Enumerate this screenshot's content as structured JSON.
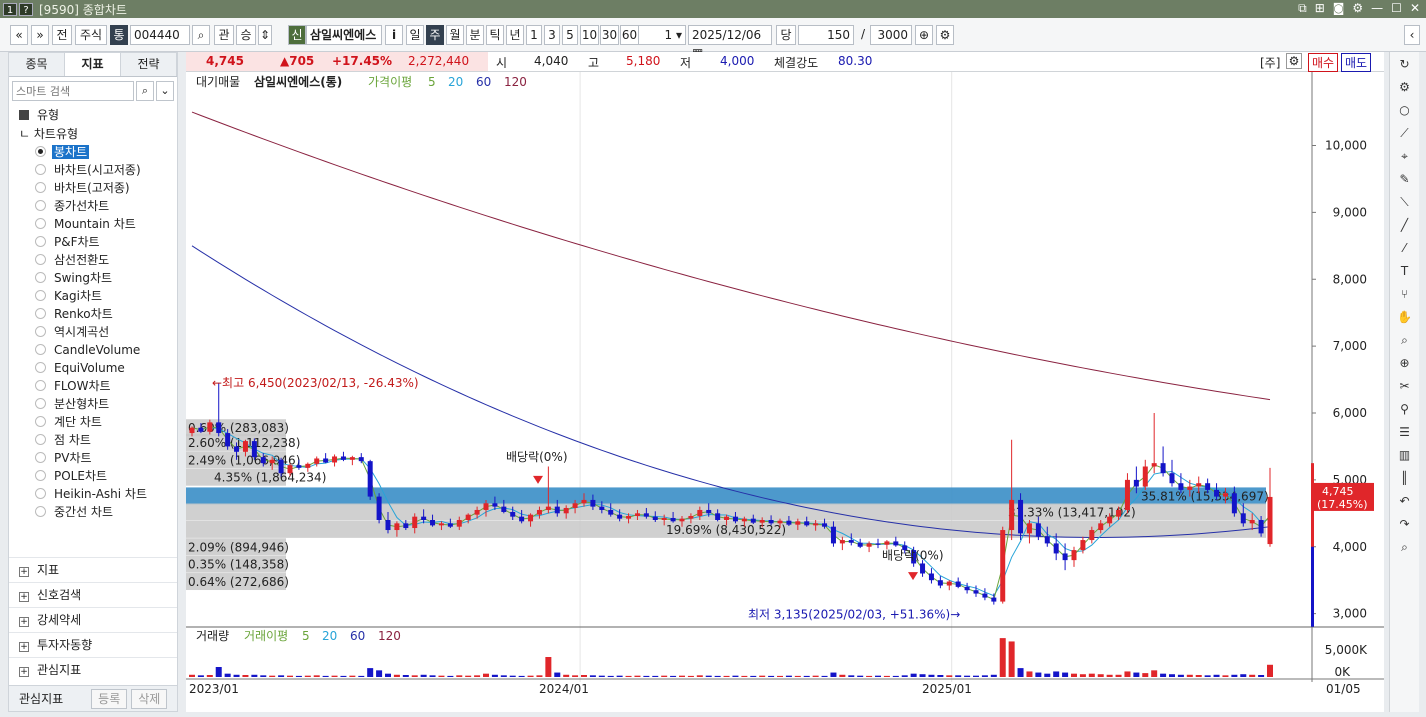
{
  "titlebar": {
    "code": "[9590]",
    "title": "종합차트",
    "box1": "1",
    "box2": "?"
  },
  "toolbar": {
    "btn_prev": "«",
    "btn_down": "»",
    "btn_jeon": "전",
    "btn_stock": "주식",
    "btn_tong": "통",
    "code": "004440",
    "btn_gwan": "관",
    "btn_seung": "승",
    "badge_new": "신",
    "name": "삼일씨엔에스",
    "btn_info": "i",
    "periods": [
      "일",
      "주",
      "월",
      "분",
      "틱",
      "년"
    ],
    "active_period": "주",
    "intervals": [
      "1",
      "3",
      "5",
      "10",
      "30",
      "60"
    ],
    "interval_value": "1",
    "date": "2025/12/06",
    "btn_dang": "당",
    "count": "150",
    "slash": "/",
    "total": "3000"
  },
  "sidebar": {
    "tabs": [
      "종목",
      "지표",
      "전략"
    ],
    "active_tab": "지표",
    "search_placeholder": "스마트 검색",
    "section_type": "유형",
    "chart_type_header": "차트유형",
    "chart_types": [
      "봉차트",
      "바차트(시고저종)",
      "바차트(고저종)",
      "종가선차트",
      "Mountain 차트",
      "P&F차트",
      "삼선전환도",
      "Swing차트",
      "Kagi차트",
      "Renko차트",
      "역시계곡선",
      "CandleVolume",
      "EquiVolume",
      "FLOW차트",
      "분산형차트",
      "계단 차트",
      "점 차트",
      "PV차트",
      "POLE차트",
      "Heikin-Ashi 차트",
      "중간선 차트"
    ],
    "selected_type": "봉차트",
    "groups": [
      "지표",
      "신호검색",
      "강세약세",
      "투자자동향",
      "관심지표"
    ],
    "watch_label": "관심지표",
    "watch_add": "등록",
    "watch_del": "삭제"
  },
  "pricebar": {
    "price": "4,745",
    "change": "▲705",
    "change_pct": "+17.45%",
    "volume": "2,272,440",
    "open_label": "시",
    "open": "4,040",
    "high_label": "고",
    "high": "5,180",
    "low_label": "저",
    "low": "4,000",
    "strength_label": "체결강도",
    "strength": "80.30",
    "unit_label": "[주]",
    "buy": "매수",
    "sell": "매도"
  },
  "legend": {
    "main": "대기매물",
    "name": "삼일씨엔에스(통)",
    "ma_label": "가격이평",
    "ma": [
      "5",
      "20",
      "60",
      "120"
    ],
    "vol": "거래량",
    "vol_ma_label": "거래이평",
    "vol_ma": [
      "5",
      "20",
      "60",
      "120"
    ]
  },
  "colors": {
    "up": "#e0262a",
    "down": "#1414c8",
    "ma5": "#6aa43a",
    "ma20": "#28a4d8",
    "ma60": "#2630a8",
    "ma120": "#8a2240",
    "band": "#3a8ec6",
    "band_gray": "#c8c8c8"
  },
  "annotations": {
    "high": "←최고 6,450(2023/02/13, -26.43%)",
    "low": "최저 3,135(2025/02/03, +51.36%)→",
    "div1": "배당락(0%)",
    "div2": "배당락(0%)"
  },
  "chart_data": {
    "type": "candlestick",
    "x_ticks": [
      "2023/01",
      "2024/01",
      "2025/01",
      "01/05"
    ],
    "y_ticks": [
      "10,000",
      "9,000",
      "8,000",
      "7,000",
      "6,000",
      "5,000",
      "4,000",
      "3,000"
    ],
    "ylim": [
      2800,
      10800
    ],
    "last_price_label": "4,745",
    "last_price_pct": "(17.45%)",
    "volume_ticks": [
      "5,000K",
      "0K"
    ],
    "volume_profile": [
      {
        "price": 5780,
        "label": "0.60% (283,083)"
      },
      {
        "price": 5560,
        "label": "2.60% (1,112,238)"
      },
      {
        "price": 5300,
        "label": "2.49% (1,066,946)"
      },
      {
        "price": 5040,
        "label": "4.35% (1,864,234)"
      },
      {
        "price": 4760,
        "label": "35.81% (15,334,697)"
      },
      {
        "price": 4520,
        "label": "31.33% (13,417,102)"
      },
      {
        "price": 4260,
        "label": "19.69% (8,430,522)"
      },
      {
        "price": 4000,
        "label": "2.09% (894,946)"
      },
      {
        "price": 3740,
        "label": "0.35% (148,358)"
      },
      {
        "price": 3480,
        "label": "0.64% (272,686)"
      }
    ],
    "candles": [
      [
        5700,
        5800,
        5650,
        5780
      ],
      [
        5780,
        5850,
        5700,
        5720
      ],
      [
        5720,
        5900,
        5680,
        5860
      ],
      [
        5860,
        6450,
        5650,
        5700
      ],
      [
        5700,
        5760,
        5450,
        5500
      ],
      [
        5500,
        5560,
        5300,
        5420
      ],
      [
        5420,
        5600,
        5350,
        5580
      ],
      [
        5580,
        5620,
        5300,
        5340
      ],
      [
        5340,
        5400,
        5200,
        5250
      ],
      [
        5250,
        5350,
        5150,
        5300
      ],
      [
        5300,
        5330,
        5050,
        5100
      ],
      [
        5100,
        5250,
        5050,
        5220
      ],
      [
        5220,
        5300,
        5150,
        5180
      ],
      [
        5180,
        5260,
        5120,
        5240
      ],
      [
        5240,
        5350,
        5200,
        5320
      ],
      [
        5320,
        5400,
        5250,
        5260
      ],
      [
        5260,
        5380,
        5200,
        5350
      ],
      [
        5350,
        5420,
        5280,
        5300
      ],
      [
        5300,
        5360,
        5220,
        5340
      ],
      [
        5340,
        5400,
        5250,
        5280
      ],
      [
        5280,
        5300,
        4700,
        4750
      ],
      [
        4750,
        4800,
        4350,
        4400
      ],
      [
        4400,
        4520,
        4200,
        4250
      ],
      [
        4250,
        4380,
        4150,
        4350
      ],
      [
        4350,
        4400,
        4250,
        4280
      ],
      [
        4280,
        4500,
        4200,
        4450
      ],
      [
        4450,
        4560,
        4350,
        4400
      ],
      [
        4400,
        4480,
        4300,
        4320
      ],
      [
        4320,
        4380,
        4250,
        4350
      ],
      [
        4350,
        4420,
        4280,
        4300
      ],
      [
        4300,
        4450,
        4250,
        4400
      ],
      [
        4400,
        4500,
        4350,
        4480
      ],
      [
        4480,
        4600,
        4420,
        4550
      ],
      [
        4550,
        4700,
        4450,
        4650
      ],
      [
        4650,
        4750,
        4550,
        4600
      ],
      [
        4600,
        4700,
        4500,
        4520
      ],
      [
        4520,
        4600,
        4400,
        4450
      ],
      [
        4450,
        4550,
        4350,
        4380
      ],
      [
        4380,
        4500,
        4300,
        4480
      ],
      [
        4480,
        4600,
        4420,
        4550
      ],
      [
        4550,
        5200,
        4500,
        4600
      ],
      [
        4600,
        4700,
        4450,
        4500
      ],
      [
        4500,
        4620,
        4420,
        4580
      ],
      [
        4580,
        4700,
        4500,
        4650
      ],
      [
        4650,
        4800,
        4600,
        4700
      ],
      [
        4700,
        4780,
        4550,
        4600
      ],
      [
        4600,
        4680,
        4500,
        4550
      ],
      [
        4550,
        4650,
        4450,
        4480
      ],
      [
        4480,
        4560,
        4380,
        4420
      ],
      [
        4420,
        4500,
        4350,
        4460
      ],
      [
        4460,
        4550,
        4400,
        4500
      ],
      [
        4500,
        4580,
        4420,
        4450
      ],
      [
        4450,
        4530,
        4370,
        4400
      ],
      [
        4400,
        4480,
        4320,
        4430
      ],
      [
        4430,
        4520,
        4360,
        4380
      ],
      [
        4380,
        4460,
        4300,
        4420
      ],
      [
        4420,
        4500,
        4350,
        4460
      ],
      [
        4460,
        4600,
        4400,
        4550
      ],
      [
        4550,
        4650,
        4450,
        4500
      ],
      [
        4500,
        4560,
        4380,
        4400
      ],
      [
        4400,
        4480,
        4320,
        4450
      ],
      [
        4450,
        4520,
        4350,
        4380
      ],
      [
        4380,
        4450,
        4300,
        4420
      ],
      [
        4420,
        4480,
        4340,
        4360
      ],
      [
        4360,
        4440,
        4290,
        4400
      ],
      [
        4400,
        4470,
        4320,
        4350
      ],
      [
        4350,
        4420,
        4280,
        4390
      ],
      [
        4390,
        4460,
        4310,
        4330
      ],
      [
        4330,
        4420,
        4250,
        4380
      ],
      [
        4380,
        4450,
        4300,
        4320
      ],
      [
        4320,
        4400,
        4240,
        4350
      ],
      [
        4350,
        4420,
        4270,
        4300
      ],
      [
        4300,
        4380,
        4000,
        4050
      ],
      [
        4050,
        4150,
        3950,
        4100
      ],
      [
        4100,
        4200,
        4020,
        4060
      ],
      [
        4060,
        4120,
        3980,
        4000
      ],
      [
        4000,
        4080,
        3920,
        4050
      ],
      [
        4050,
        4120,
        3980,
        4030
      ],
      [
        4030,
        4100,
        3960,
        4080
      ],
      [
        4080,
        4150,
        4000,
        4020
      ],
      [
        4020,
        4080,
        3900,
        3950
      ],
      [
        3950,
        4000,
        3700,
        3750
      ],
      [
        3750,
        3800,
        3550,
        3600
      ],
      [
        3600,
        3680,
        3450,
        3500
      ],
      [
        3500,
        3560,
        3380,
        3420
      ],
      [
        3420,
        3500,
        3350,
        3480
      ],
      [
        3480,
        3540,
        3380,
        3400
      ],
      [
        3400,
        3460,
        3300,
        3350
      ],
      [
        3350,
        3420,
        3250,
        3300
      ],
      [
        3300,
        3380,
        3200,
        3240
      ],
      [
        3240,
        3300,
        3135,
        3180
      ],
      [
        3180,
        4300,
        3150,
        4250
      ],
      [
        4250,
        5600,
        4100,
        4700
      ],
      [
        4700,
        4800,
        4100,
        4200
      ],
      [
        4200,
        4400,
        4050,
        4350
      ],
      [
        4350,
        4450,
        4100,
        4150
      ],
      [
        4150,
        4300,
        4000,
        4050
      ],
      [
        4050,
        4200,
        3800,
        3900
      ],
      [
        3900,
        4050,
        3650,
        3800
      ],
      [
        3800,
        4000,
        3700,
        3950
      ],
      [
        3950,
        4150,
        3900,
        4100
      ],
      [
        4100,
        4300,
        4050,
        4250
      ],
      [
        4250,
        4400,
        4200,
        4350
      ],
      [
        4350,
        4500,
        4300,
        4450
      ],
      [
        4450,
        4600,
        4400,
        4550
      ],
      [
        4550,
        5100,
        4500,
        5000
      ],
      [
        5000,
        5200,
        4800,
        4900
      ],
      [
        4900,
        5300,
        4850,
        5200
      ],
      [
        5200,
        6000,
        5100,
        5250
      ],
      [
        5250,
        5500,
        5050,
        5100
      ],
      [
        5100,
        5300,
        4900,
        4950
      ],
      [
        4950,
        5100,
        4800,
        4850
      ],
      [
        4850,
        5000,
        4750,
        4900
      ],
      [
        4900,
        5050,
        4800,
        4950
      ],
      [
        4950,
        5020,
        4800,
        4850
      ],
      [
        4850,
        4950,
        4700,
        4750
      ],
      [
        4750,
        4880,
        4650,
        4800
      ],
      [
        4800,
        4900,
        4450,
        4500
      ],
      [
        4500,
        4650,
        4300,
        4350
      ],
      [
        4350,
        4500,
        4250,
        4400
      ],
      [
        4400,
        4460,
        4150,
        4200
      ],
      [
        4040,
        5180,
        4000,
        4745
      ]
    ],
    "volumes": [
      0.2,
      0.15,
      0.18,
      0.9,
      0.3,
      0.2,
      0.18,
      0.2,
      0.15,
      0.12,
      0.15,
      0.12,
      0.1,
      0.12,
      0.15,
      0.1,
      0.12,
      0.1,
      0.12,
      0.1,
      0.8,
      0.6,
      0.3,
      0.2,
      0.18,
      0.15,
      0.2,
      0.15,
      0.12,
      0.1,
      0.15,
      0.12,
      0.15,
      0.3,
      0.2,
      0.15,
      0.12,
      0.1,
      0.12,
      0.15,
      1.8,
      0.4,
      0.2,
      0.15,
      0.18,
      0.15,
      0.12,
      0.1,
      0.12,
      0.1,
      0.12,
      0.1,
      0.1,
      0.12,
      0.1,
      0.12,
      0.1,
      0.15,
      0.12,
      0.1,
      0.1,
      0.12,
      0.1,
      0.1,
      0.12,
      0.1,
      0.1,
      0.12,
      0.1,
      0.1,
      0.12,
      0.1,
      0.4,
      0.2,
      0.15,
      0.12,
      0.1,
      0.12,
      0.1,
      0.1,
      0.15,
      0.3,
      0.25,
      0.2,
      0.18,
      0.15,
      0.15,
      0.12,
      0.12,
      0.15,
      0.2,
      3.5,
      3.2,
      0.8,
      0.5,
      0.4,
      0.3,
      0.5,
      0.4,
      0.3,
      0.25,
      0.3,
      0.25,
      0.2,
      0.2,
      0.5,
      0.4,
      0.35,
      0.6,
      0.3,
      0.25,
      0.2,
      0.2,
      0.18,
      0.15,
      0.2,
      0.15,
      0.2,
      0.25,
      0.2,
      0.18,
      1.1
    ]
  }
}
